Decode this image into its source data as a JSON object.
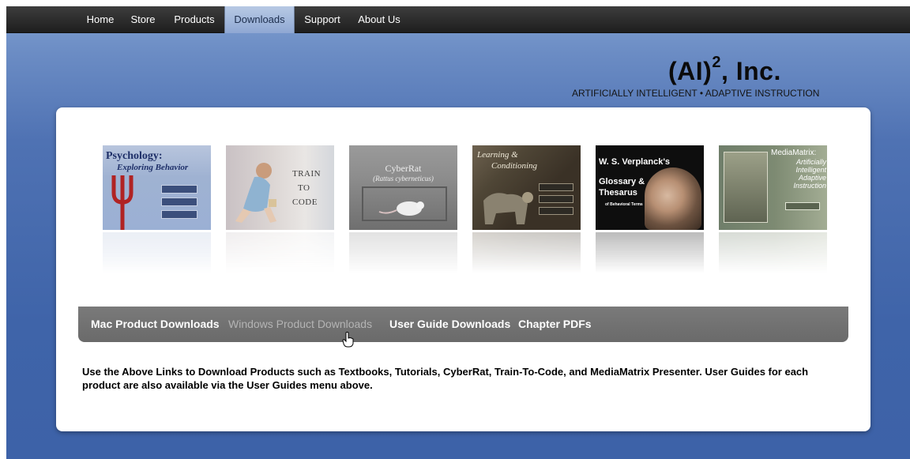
{
  "topnav": {
    "items": [
      {
        "label": "Home",
        "active": false
      },
      {
        "label": "Store",
        "active": false
      },
      {
        "label": "Products",
        "active": false
      },
      {
        "label": "Downloads",
        "active": true
      },
      {
        "label": "Support",
        "active": false
      },
      {
        "label": "About Us",
        "active": false
      }
    ]
  },
  "brand": {
    "name": "(AI)",
    "superscript": "2",
    "suffix": ", Inc.",
    "tagline": "ARTIFICIALLY INTELLIGENT • ADAPTIVE INSTRUCTION"
  },
  "covers": {
    "psychology": {
      "line1": "Psychology:",
      "line2": "Exploring Behavior"
    },
    "train": {
      "line1": "TRAIN",
      "line2": "TO",
      "line3": "CODE"
    },
    "cyberrat": {
      "title": "CyberRat",
      "subtitle": "(Rattus cyberneticus)"
    },
    "learning": {
      "line1": "Learning &",
      "line2": "Conditioning"
    },
    "verplanck": {
      "line1": "W. S. Verplanck's",
      "line2": "Glossary &",
      "line3": "Thesarus",
      "line4": "of Behavioral Terms"
    },
    "mediamatrix": {
      "title": "MediaMatrix:",
      "subtitle": "Artificially Intelligent Adaptive Instruction"
    }
  },
  "subnav": {
    "items": [
      {
        "label": "Mac Product Downloads",
        "state": "normal"
      },
      {
        "label": "Windows Product Downloads",
        "state": "hover"
      },
      {
        "label": "User Guide Downloads",
        "state": "normal"
      },
      {
        "label": "Chapter PDFs",
        "state": "normal"
      }
    ]
  },
  "description": "Use the Above Links to Download Products such as Textbooks, Tutorials, CyberRat, Train-To-Code, and MediaMatrix Presenter. User Guides for each product are also available via the User Guides menu above.",
  "colors": {
    "background_top": "#7f9fd0",
    "background_bottom": "#3d62a8",
    "nav_bar": "#2b2b2b",
    "nav_active": "#a9bedf",
    "subnav_bar": "#707070",
    "subnav_dim_text": "#b4b4b4"
  }
}
